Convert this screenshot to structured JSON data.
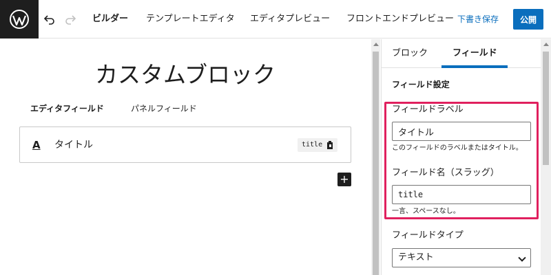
{
  "colors": {
    "accent": "#0a6ebd",
    "highlight": "#e0205e",
    "dark": "#1e1e1e"
  },
  "header": {
    "logo_icon": "wordpress-icon",
    "undo_icon": "undo-icon",
    "redo_icon": "redo-icon",
    "tabs": [
      {
        "label": "ビルダー",
        "active": true
      },
      {
        "label": "テンプレートエディタ",
        "active": false
      },
      {
        "label": "エディタプレビュー",
        "active": false
      },
      {
        "label": "フロントエンドプレビュー",
        "active": false
      }
    ],
    "save_draft": "下書き保存",
    "publish": "公開"
  },
  "main": {
    "block_title": "カスタムブロック",
    "field_tabs": [
      {
        "label": "エディタフィールド",
        "active": true
      },
      {
        "label": "パネルフィールド",
        "active": false
      }
    ],
    "field": {
      "type_icon": "A",
      "label": "タイトル",
      "slug": "title"
    },
    "add_icon": "+"
  },
  "sidebar": {
    "tabs": [
      {
        "label": "ブロック",
        "active": false
      },
      {
        "label": "フィールド",
        "active": true
      }
    ],
    "section_title": "フィールド設定",
    "label_field": {
      "label": "フィールドラベル",
      "value": "タイトル",
      "help": "このフィールドのラベルまたはタイトル。"
    },
    "name_field": {
      "label": "フィールド名（スラッグ）",
      "value": "title",
      "help": "一言、スペースなし。"
    },
    "type_field": {
      "label": "フィールドタイプ",
      "value": "テキスト"
    }
  }
}
